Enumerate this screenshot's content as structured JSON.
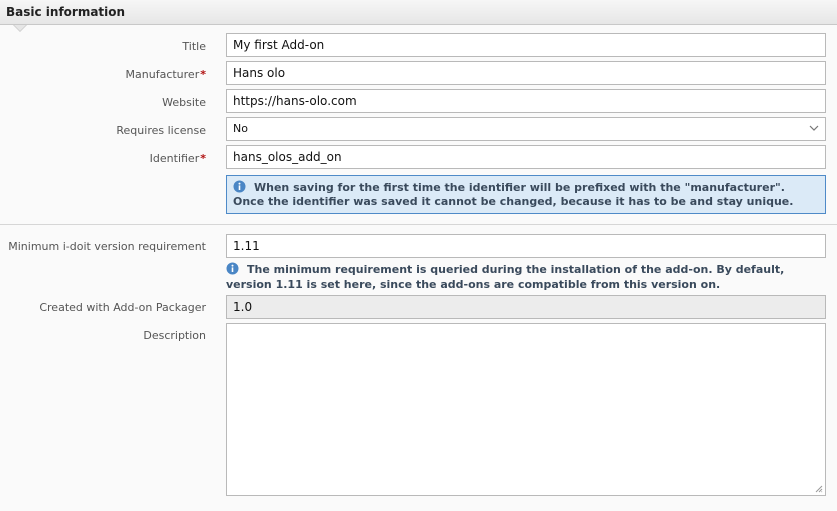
{
  "section": {
    "title": "Basic information"
  },
  "form": {
    "title": {
      "label": "Title",
      "value": "My first Add-on"
    },
    "manufacturer": {
      "label": "Manufacturer",
      "required_mark": "*",
      "value": "Hans olo"
    },
    "website": {
      "label": "Website",
      "value": "https://hans-olo.com"
    },
    "requires_license": {
      "label": "Requires license",
      "value": "No"
    },
    "identifier": {
      "label": "Identifier",
      "required_mark": "*",
      "value": "hans_olos_add_on"
    },
    "identifier_info": "When saving for the first time the identifier will be prefixed with the \"manufacturer\". Once the identifier was saved it cannot be changed, because it has to be and stay unique.",
    "min_version": {
      "label": "Minimum i-doit version requirement",
      "value": "1.11"
    },
    "min_version_info": "The minimum requirement is queried during the installation of the add-on. By default, version 1.11 is set here, since the add-ons are compatible from this version on.",
    "packager_version": {
      "label": "Created with Add-on Packager",
      "value": "1.0"
    },
    "description": {
      "label": "Description",
      "value": ""
    }
  },
  "colors": {
    "required": "#b01010",
    "info_background": "#dbeaf7",
    "info_border": "#4e8ac8",
    "info_icon": "#4a86c5"
  },
  "icons": {
    "info": "info-icon",
    "dropdown": "chevron-down-icon",
    "resize": "resize-grip-icon"
  }
}
